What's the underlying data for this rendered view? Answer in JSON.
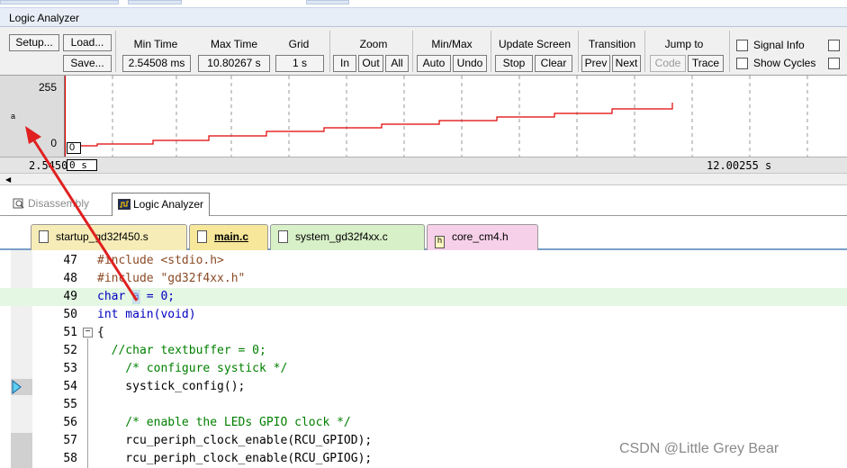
{
  "logic_analyzer": {
    "title": "Logic Analyzer",
    "setup_label": "Setup...",
    "load_label": "Load...",
    "save_label": "Save...",
    "min_time_label": "Min Time",
    "min_time_value": "2.54508 ms",
    "max_time_label": "Max Time",
    "max_time_value": "10.80267 s",
    "grid_label": "Grid",
    "grid_value": "1 s",
    "zoom_label": "Zoom",
    "zoom_in": "In",
    "zoom_out": "Out",
    "zoom_all": "All",
    "minmax_label": "Min/Max",
    "auto_label": "Auto",
    "undo_label": "Undo",
    "update_screen_label": "Update Screen",
    "stop_label": "Stop",
    "clear_label": "Clear",
    "transition_label": "Transition",
    "prev_label": "Prev",
    "next_label": "Next",
    "jump_to_label": "Jump to",
    "code_label": "Code",
    "trace_label": "Trace",
    "signal_info_label": "Signal Info",
    "show_cycles_label": "Show Cycles",
    "signal_name": "a",
    "y_max": "255",
    "y_min": "0",
    "cursor_value": "0",
    "cursor_time": "0 s",
    "time_start": "2.5450",
    "time_end": "12.00255 s"
  },
  "window_tabs": [
    {
      "label": "Disassembly",
      "icon": "disassembly-icon"
    },
    {
      "label": "Logic Analyzer",
      "icon": "logic-analyzer-icon"
    }
  ],
  "file_tabs": [
    {
      "label": "startup_gd32f450.s",
      "icon": "file-icon"
    },
    {
      "label": "main.c",
      "icon": "file-icon"
    },
    {
      "label": "system_gd32f4xx.c",
      "icon": "file-icon"
    },
    {
      "label": "core_cm4.h",
      "icon": "header-file-icon"
    }
  ],
  "code_lines": [
    {
      "num": "47",
      "text": "#include <stdio.h>"
    },
    {
      "num": "48",
      "text": "#include \"gd32f4xx.h\""
    },
    {
      "num": "49",
      "text": "char a = 0;"
    },
    {
      "num": "50",
      "text": "int main(void)"
    },
    {
      "num": "51",
      "text": "{"
    },
    {
      "num": "52",
      "text": "  //char textbuffer = 0;"
    },
    {
      "num": "53",
      "text": "    /* configure systick */"
    },
    {
      "num": "54",
      "text": "    systick_config();"
    },
    {
      "num": "55",
      "text": ""
    },
    {
      "num": "56",
      "text": "    /* enable the LEDs GPIO clock */"
    },
    {
      "num": "57",
      "text": "    rcu_periph_clock_enable(RCU_GPIOD);"
    },
    {
      "num": "58",
      "text": "    rcu_periph_clock_enable(RCU_GPIOG);"
    }
  ],
  "watermark": "CSDN @Little Grey Bear",
  "colors": {
    "waveform": "#e00000",
    "annotation_arrow": "#e02020",
    "highlight_line": "#e3f7e3"
  }
}
